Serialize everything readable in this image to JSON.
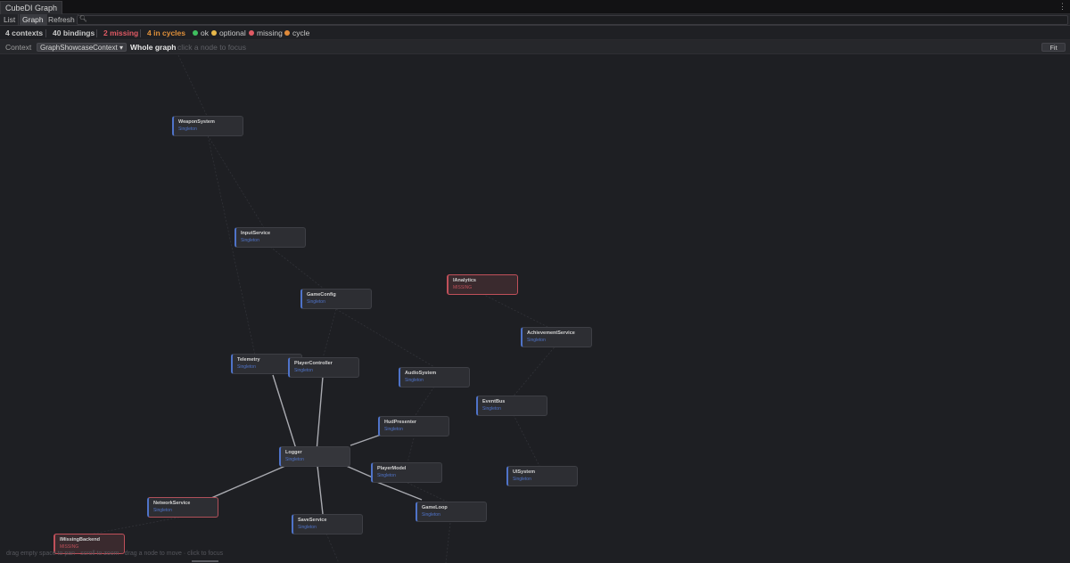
{
  "window": {
    "title": "CubeDI Graph",
    "menu_icon": "kebab-menu-icon"
  },
  "toolbar": {
    "list_label": "List",
    "graph_label": "Graph",
    "refresh_label": "Refresh",
    "search_icon": "search-icon",
    "search_value": ""
  },
  "stats": {
    "contexts": "4 contexts",
    "bindings": "40 bindings",
    "missing": "2 missing",
    "cycles": "4 in cycles",
    "legend": [
      {
        "label": "ok",
        "color": "#3fbf5f"
      },
      {
        "label": "optional",
        "color": "#e8b84a"
      },
      {
        "label": "missing",
        "color": "#e05a64"
      },
      {
        "label": "cycle",
        "color": "#e08a3a"
      }
    ],
    "colors": {
      "missing": "#e05a64",
      "cycles": "#e0903a"
    }
  },
  "context": {
    "label": "Context",
    "selected": "GraphShowcaseContext",
    "dropdown_icon": "caret-down-icon",
    "view": "Whole graph",
    "hint": "click a node to focus",
    "fit_label": "Fit"
  },
  "graph": {
    "accent": "#4f73c9",
    "missing_color": "#c0505a",
    "nodes": [
      {
        "id": "WeaponSystem",
        "name": "WeaponSystem",
        "lifetime": "Singleton",
        "status": "ok"
      },
      {
        "id": "InputService",
        "name": "InputService",
        "lifetime": "Singleton",
        "status": "ok"
      },
      {
        "id": "IAnalytics",
        "name": "IAnalytics",
        "lifetime": "MISSING",
        "status": "missing"
      },
      {
        "id": "GameConfig",
        "name": "GameConfig",
        "lifetime": "Singleton",
        "status": "ok"
      },
      {
        "id": "AchievementService",
        "name": "AchievementService",
        "lifetime": "Singleton",
        "status": "ok"
      },
      {
        "id": "Telemetry",
        "name": "Telemetry",
        "lifetime": "Singleton",
        "status": "ok"
      },
      {
        "id": "PlayerController",
        "name": "PlayerController",
        "lifetime": "Singleton",
        "status": "ok"
      },
      {
        "id": "AudioSystem",
        "name": "AudioSystem",
        "lifetime": "Singleton",
        "status": "ok"
      },
      {
        "id": "EventBus",
        "name": "EventBus",
        "lifetime": "Singleton",
        "status": "ok"
      },
      {
        "id": "HudPresenter",
        "name": "HudPresenter",
        "lifetime": "Singleton",
        "status": "ok"
      },
      {
        "id": "Logger",
        "name": "Logger",
        "lifetime": "Singleton",
        "status": "ok"
      },
      {
        "id": "PlayerModel",
        "name": "PlayerModel",
        "lifetime": "Singleton",
        "status": "ok"
      },
      {
        "id": "UISystem",
        "name": "UISystem",
        "lifetime": "Singleton",
        "status": "ok"
      },
      {
        "id": "NetworkService",
        "name": "NetworkService",
        "lifetime": "Singleton",
        "status": "ok"
      },
      {
        "id": "GameLoop",
        "name": "GameLoop",
        "lifetime": "Singleton",
        "status": "ok"
      },
      {
        "id": "SaveService",
        "name": "SaveService",
        "lifetime": "Singleton",
        "status": "ok"
      },
      {
        "id": "IMissingBackend",
        "name": "IMissingBackend",
        "lifetime": "MISSING",
        "status": "missing"
      }
    ]
  },
  "footer": {
    "hint": "drag empty space to pan · scroll to zoom · drag a node to move · click to focus"
  }
}
